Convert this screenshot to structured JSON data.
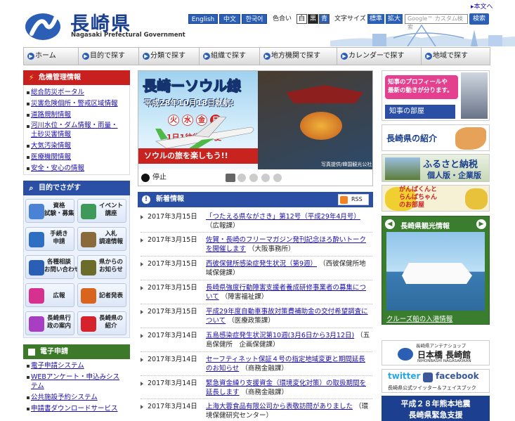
{
  "header": {
    "site_title": "長崎県",
    "site_subtitle": "Nagasaki Prefectural Government",
    "text_version_link": "本文へ",
    "languages": [
      "English",
      "中文",
      "한국어"
    ],
    "color_label": "色合い",
    "color_options": [
      "白",
      "黒",
      "青"
    ],
    "font_size_label": "文字サイズ",
    "font_size_options": [
      "標準",
      "拡大"
    ],
    "search_placeholder": "Google™ カスタム検索",
    "search_button": "検索"
  },
  "nav": {
    "items": [
      "ホーム",
      "目的で探す",
      "分類で探す",
      "組織で探す",
      "地方機関で探す",
      "カレンダーで探す",
      "地域で探す"
    ]
  },
  "crisis": {
    "title": "危機管理情報",
    "items": [
      "総合防災ポータル",
      "災害危険個所・警戒区域情報",
      "道路規制情報",
      "河川水位・ダム情報・雨量・",
      "土砂災害情報",
      "大気汚染情報",
      "医療機関情報",
      "安全・安心の情報"
    ]
  },
  "purpose": {
    "title": "目的でさがす",
    "tiles": [
      {
        "label": "資格\n試験・募集",
        "icon": "pencil-icon"
      },
      {
        "label": "イベント\n講座",
        "icon": "event-icon"
      },
      {
        "label": "手続き\n申請",
        "icon": "map-icon"
      },
      {
        "label": "入札\n調達情報",
        "icon": "tender-icon"
      },
      {
        "label": "各種相談\nお問い合わせ",
        "icon": "person-icon"
      },
      {
        "label": "県からの\nお知らせ",
        "icon": "message-icon"
      },
      {
        "label": "広報",
        "icon": "camera-icon"
      },
      {
        "label": "記者発表",
        "icon": "microphone-icon"
      },
      {
        "label": "長崎県行\n政の案内",
        "icon": "chart-icon"
      },
      {
        "label": "長崎県の\n紹介",
        "icon": "leaf-icon"
      }
    ]
  },
  "electronic": {
    "title": "電子申請",
    "items": [
      "電子申請システム",
      "WEBアンケート・申込みシス",
      "テム",
      "公共施設予約システム",
      "申請書ダウンロードサービス"
    ]
  },
  "slider": {
    "headline": "長崎ーソウル線",
    "subhead": "平成28年10月18日就航!",
    "days": [
      "火",
      "水",
      "金",
      "日"
    ],
    "frequency": "1日1往復週4便",
    "tagline": "ソウルの旅を楽しもう!!",
    "credit": "写真提供/韓国観光公社",
    "stop_label": "停止",
    "dots_total": 5,
    "active_dot": 1
  },
  "news": {
    "title": "新着情報",
    "rss": "RSS",
    "items": [
      {
        "date": "2017年3月15日",
        "title": "「つたえる県ながさき」第12号（平成29年4月号）",
        "dept": "（広報課）"
      },
      {
        "date": "2017年3月15日",
        "title": "佐賀・長崎のフリーマガジン発刊記念ほろ酔いトークを開催します",
        "dept": "（大阪事務所）"
      },
      {
        "date": "2017年3月15日",
        "title": "西彼保健所感染症発生状況（第9週）",
        "dept": "（西彼保健所地域保健課）"
      },
      {
        "date": "2017年3月15日",
        "title": "長崎県強度行動障害支援者養成研修事業者の募集について",
        "dept": "（障害福祉課）"
      },
      {
        "date": "2017年3月15日",
        "title": "平成29年度自動車事故対策費補助金の交付希望調査について",
        "dept": "（医療政策課）"
      },
      {
        "date": "2017年3月14日",
        "title": "五島感染症発生状況第10週(3月6日から3月12日)",
        "dept": "（五島保健所　企画保健課）"
      },
      {
        "date": "2017年3月14日",
        "title": "セーフティネット保証４号の指定地域変更と期間延長のお知らせ",
        "dept": "（商務金融課）"
      },
      {
        "date": "2017年3月14日",
        "title": "緊急資金繰り支援資金（環境変化対策）の取扱期間を延長します",
        "dept": "（商務金融課）"
      },
      {
        "date": "2017年3月14日",
        "title": "上海大蓉食品有限公司から表敬訪問がありました",
        "dept": "（環境保健研究センター）"
      }
    ]
  },
  "right": {
    "governor_text": "知事のプロフィールや\n最新の動きが分ります。",
    "governor_label": "知事の部屋",
    "intro": "長崎県の紹介",
    "furusato_title": "ふるさと納税",
    "furusato_sub": "個人版・企業版",
    "ganbakun": "がんばくんと\nらんばちゃん\nのお部屋",
    "tourism_title": "長崎県観光情報",
    "cruise_link": "クルーズ船の入港情報",
    "antenna_small": "長崎県アンテナショップ",
    "antenna_name": "日本橋 長崎館",
    "antenna_en": "NIHONBASHI NAGASAKIKAN",
    "twitter_word": "twitter",
    "facebook_word": "facebook",
    "social_caption": "長崎県公式ツイッター＆フェイスブック",
    "quake_line1": "平成２８年熊本地震",
    "quake_line2": "長崎県緊急支援"
  },
  "colors": {
    "brand_blue": "#2a5fb5",
    "crisis_red": "#c8201e",
    "nav_blue": "#2a4fa5",
    "green_section": "#3c7a2a",
    "tourism_green": "#3a7d2e"
  }
}
